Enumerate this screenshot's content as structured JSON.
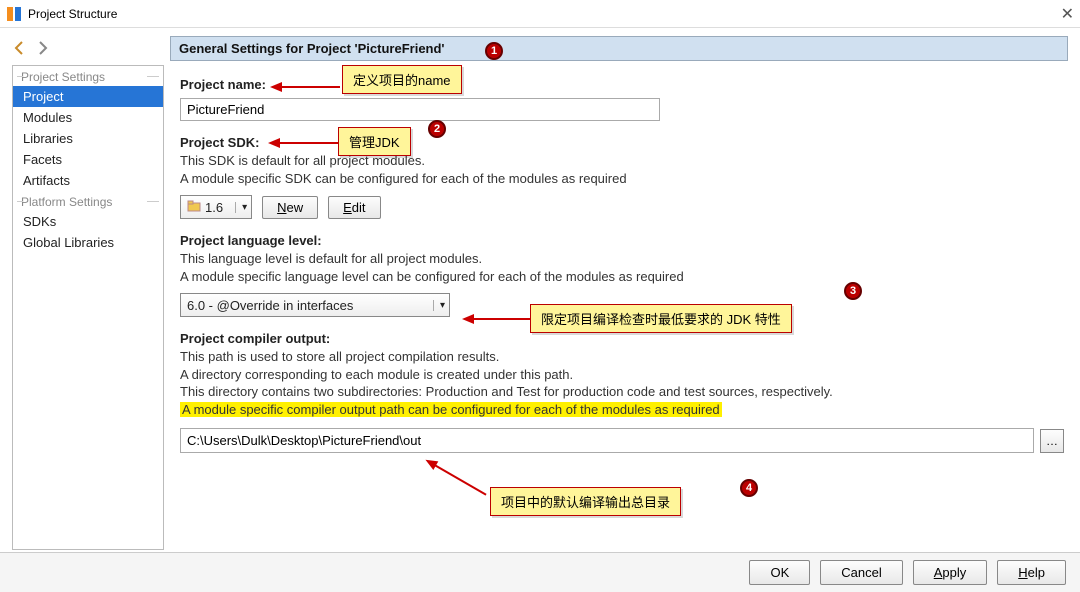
{
  "window": {
    "title": "Project Structure"
  },
  "sidebar": {
    "group1": "Project Settings",
    "group2": "Platform Settings",
    "items1": [
      "Project",
      "Modules",
      "Libraries",
      "Facets",
      "Artifacts"
    ],
    "items2": [
      "SDKs",
      "Global Libraries"
    ]
  },
  "header": {
    "text": "General Settings for Project 'PictureFriend'"
  },
  "projectName": {
    "label": "Project name:",
    "value": "PictureFriend"
  },
  "sdk": {
    "label": "Project SDK:",
    "desc1": "This SDK is default for all project modules.",
    "desc2": "A module specific SDK can be configured for each of the modules as required",
    "selected": "1.6",
    "newBtn": "New",
    "editBtn": "Edit"
  },
  "langLevel": {
    "label": "Project language level:",
    "desc1": "This language level is default for all project modules.",
    "desc2": "A module specific language level can be configured for each of the modules as required",
    "selected": "6.0 - @Override in interfaces"
  },
  "compiler": {
    "label": "Project compiler output:",
    "desc1": "This path is used to store all project compilation results.",
    "desc2": "A directory corresponding to each module is created under this path.",
    "desc3": "This directory contains two subdirectories: Production and Test for production code and test sources, respectively.",
    "desc4": "A module specific compiler output path can be configured for each of the modules as required",
    "path": "C:\\Users\\Dulk\\Desktop\\PictureFriend\\out"
  },
  "footer": {
    "ok": "OK",
    "cancel": "Cancel",
    "apply": "Apply",
    "help": "Help"
  },
  "annotations": {
    "a1": "定义项目的name",
    "a2": "管理JDK",
    "a3": "限定项目编译检查时最低要求的 JDK 特性",
    "a4": "项目中的默认编译输出总目录"
  }
}
